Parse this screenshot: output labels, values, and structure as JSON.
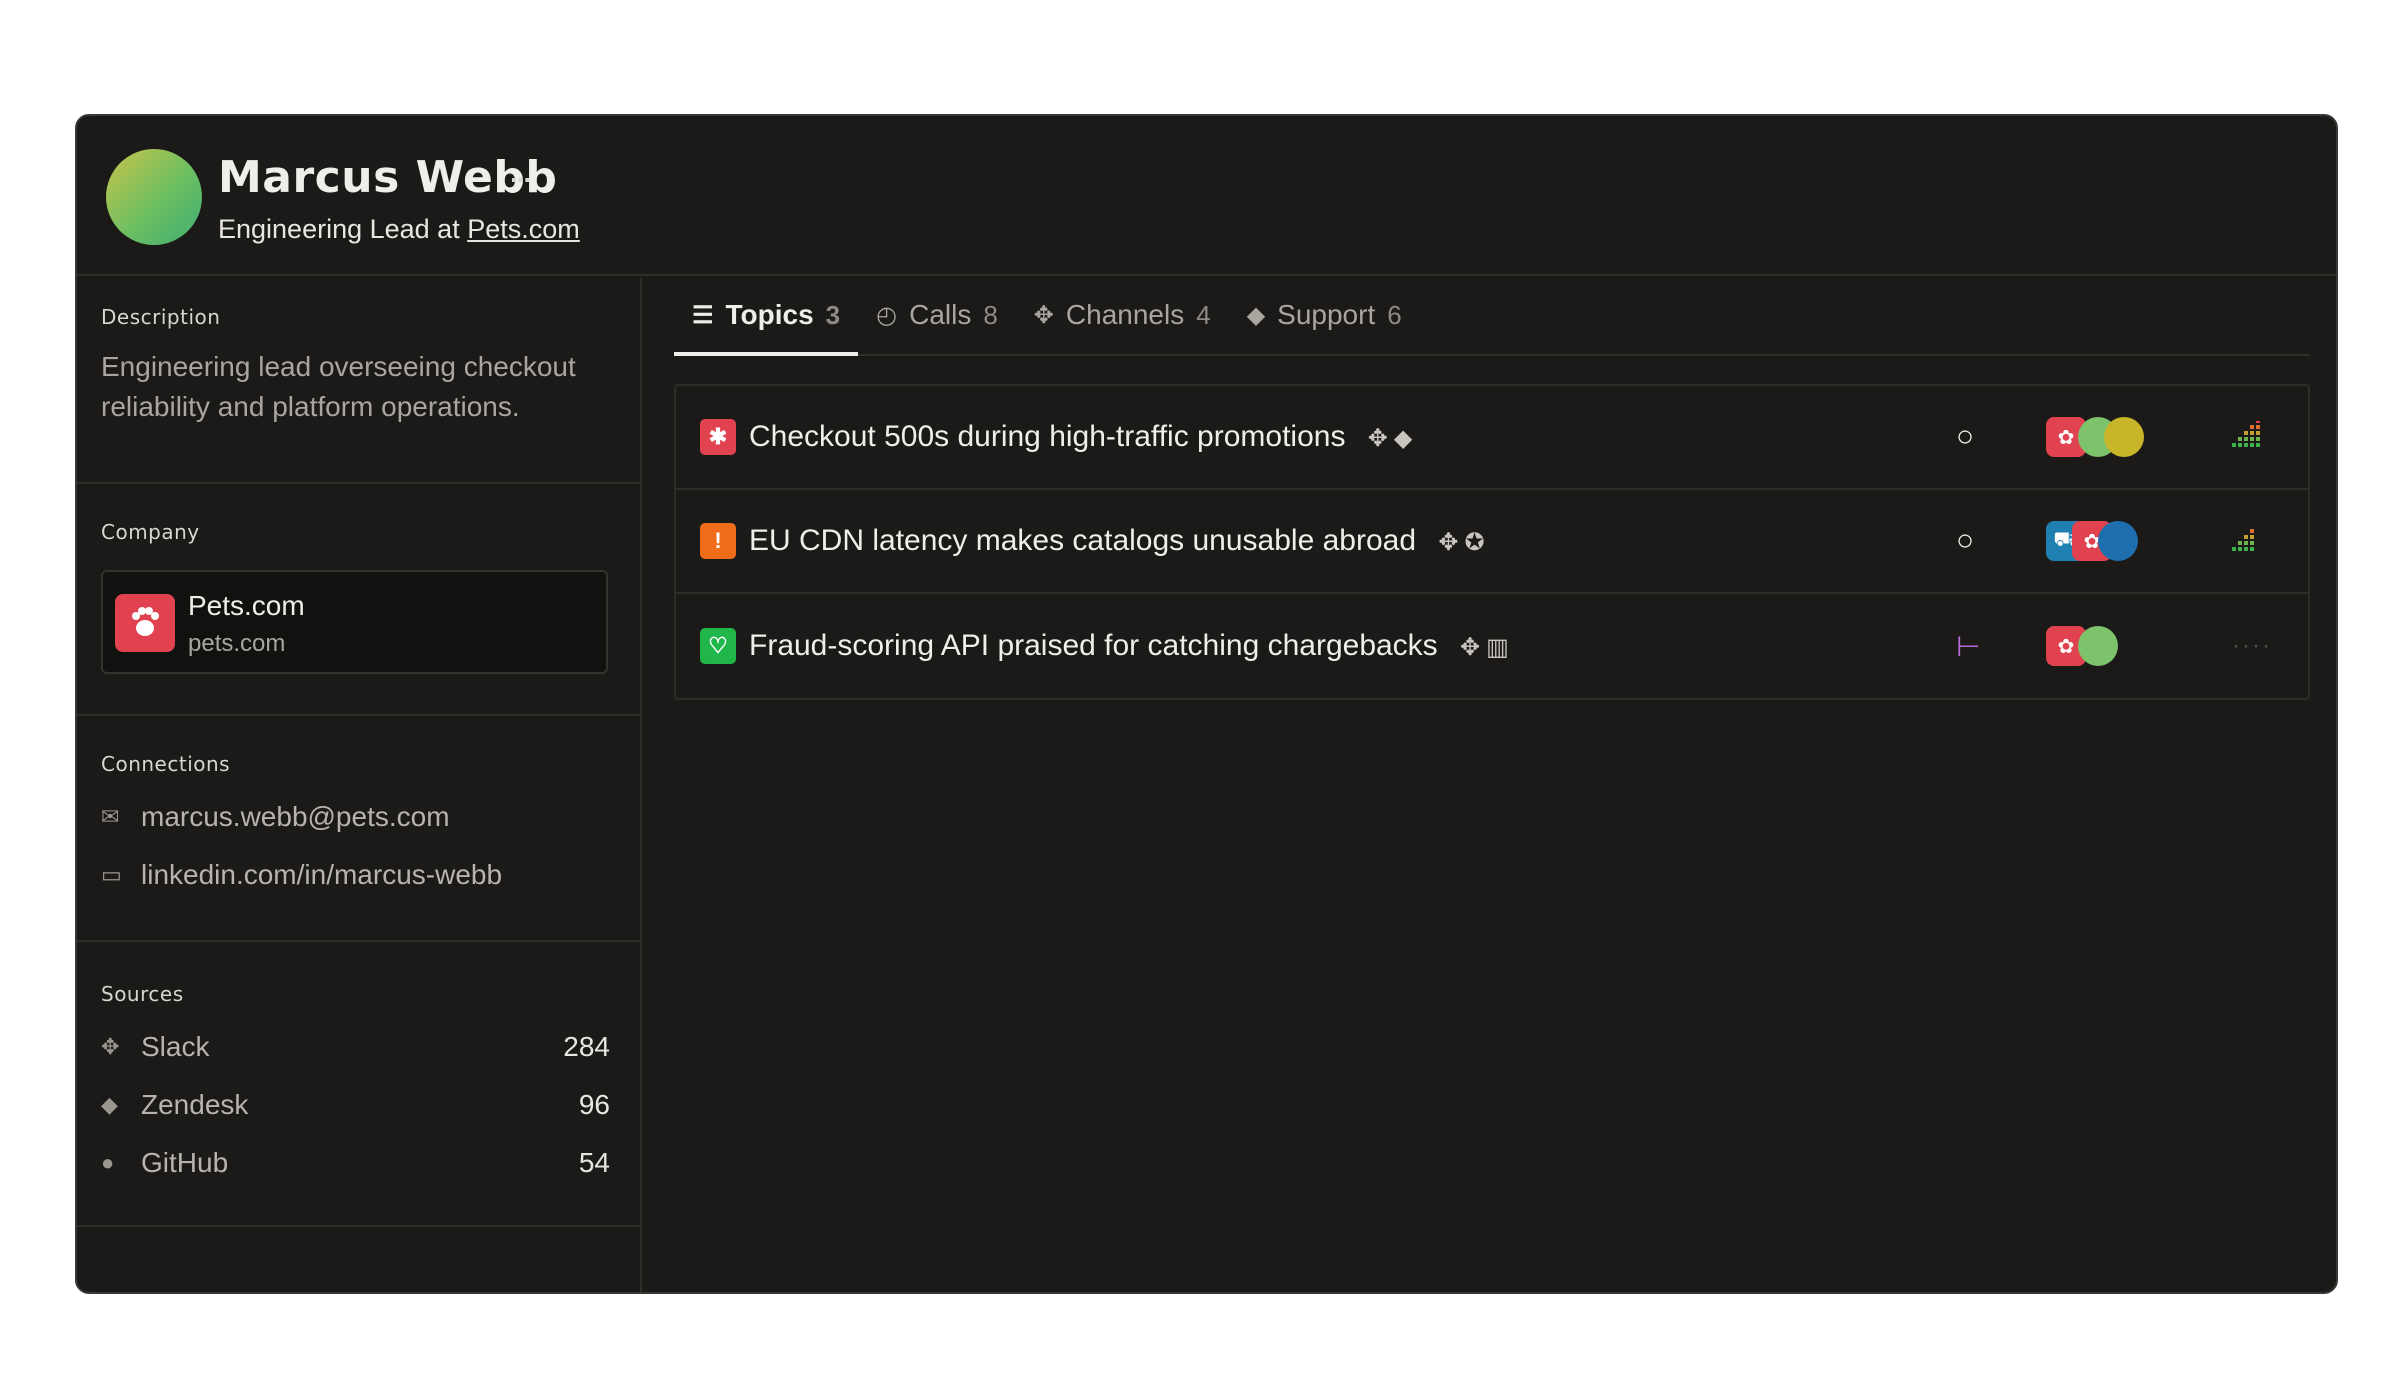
{
  "profile": {
    "name": "Marcus Webb",
    "role_prefix": "Engineering Lead at",
    "company_link": "Pets.com"
  },
  "sidebar": {
    "description": {
      "title": "Description",
      "text": "Engineering lead overseeing checkout reliability and platform operations."
    },
    "company": {
      "title": "Company",
      "name": "Pets.com",
      "domain": "pets.com"
    },
    "connections": {
      "title": "Connections",
      "items": [
        {
          "icon": "mail-icon",
          "label": "marcus.webb@pets.com"
        },
        {
          "icon": "linkedin-icon",
          "label": "linkedin.com/in/marcus-webb"
        }
      ]
    },
    "sources": {
      "title": "Sources",
      "items": [
        {
          "icon": "slack-icon",
          "label": "Slack",
          "count": "284"
        },
        {
          "icon": "zendesk-icon",
          "label": "Zendesk",
          "count": "96"
        },
        {
          "icon": "github-icon",
          "label": "GitHub",
          "count": "54"
        }
      ]
    }
  },
  "tabs": [
    {
      "label": "Topics",
      "count": "3",
      "icon": "inbox-icon",
      "active": true
    },
    {
      "label": "Calls",
      "count": "8",
      "icon": "calls-icon",
      "active": false
    },
    {
      "label": "Channels",
      "count": "4",
      "icon": "slack-icon",
      "active": false
    },
    {
      "label": "Support",
      "count": "6",
      "icon": "zendesk-icon",
      "active": false
    }
  ],
  "topics": [
    {
      "title": "Checkout 500s during high-traffic promotions",
      "badge": "bug-icon",
      "badge_color": "#e0434f",
      "status": "open-circle-icon",
      "priority": "high"
    },
    {
      "title": "EU CDN latency makes catalogs unusable abroad",
      "badge": "alert-icon",
      "badge_color": "#ef6c1a",
      "status": "open-circle-icon",
      "priority": "high"
    },
    {
      "title": "Fraud-scoring API praised for catching chargebacks",
      "badge": "heart-icon",
      "badge_color": "#21b64a",
      "status": "merge-icon",
      "priority": "none"
    }
  ],
  "colors": {
    "background": "#1b1a18",
    "accent_red": "#e0434f",
    "accent_orange": "#ef6c1a",
    "accent_green": "#21b64a",
    "accent_purple": "#b86bd8"
  }
}
